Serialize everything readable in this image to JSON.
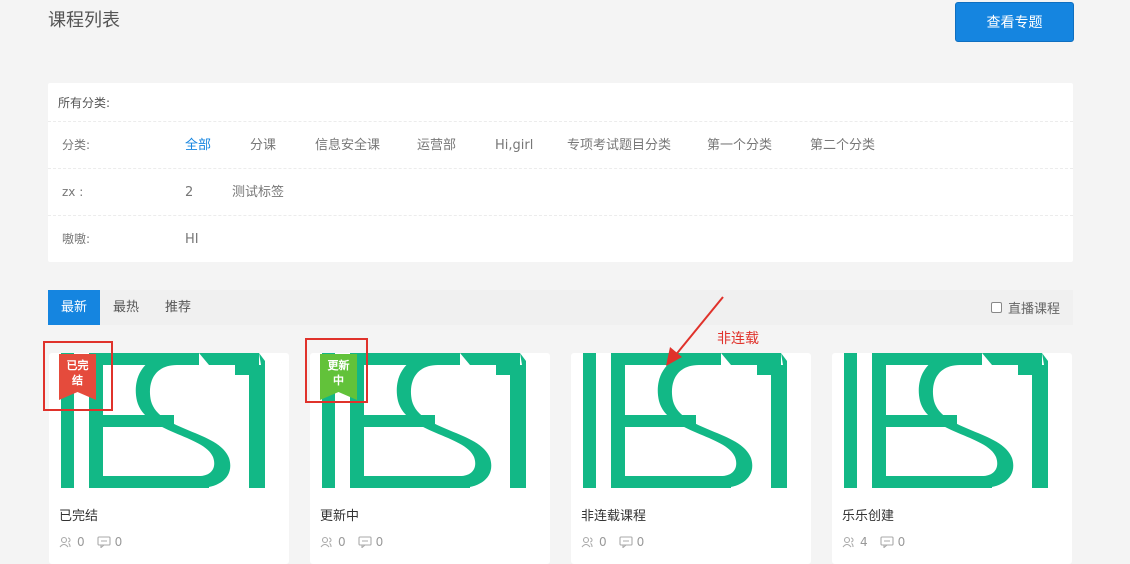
{
  "header": {
    "title": "课程列表",
    "topic_button": "查看专题"
  },
  "filters": {
    "heading": "所有分类:",
    "category": {
      "label": "分类:",
      "options": [
        "全部",
        "分课",
        "信息安全课",
        "运营部",
        "Hi,girl",
        "专项考试题目分类",
        "第一个分类",
        "第二个分类"
      ]
    },
    "zx": {
      "label": "zx :",
      "options": [
        "2",
        "测试标签"
      ]
    },
    "tag3": {
      "label": "嗷嗷:",
      "options": [
        "HI"
      ]
    }
  },
  "tabs": {
    "items": [
      "最新",
      "最热",
      "推荐"
    ],
    "live_label": "直播课程"
  },
  "courses": [
    {
      "title": "已完结",
      "learners": "0",
      "comments": "0",
      "badge": "已完\n结"
    },
    {
      "title": "更新中",
      "learners": "0",
      "comments": "0",
      "badge": "更新\n中"
    },
    {
      "title": "非连载课程",
      "learners": "0",
      "comments": "0"
    },
    {
      "title": "乐乐创建",
      "learners": "4",
      "comments": "0"
    }
  ],
  "annotation": "非连载",
  "colors": {
    "accent": "#1585e0",
    "logo": "#12b886",
    "ribbon_done": "#e54b3c",
    "ribbon_updating": "#62c23a",
    "highlight": "#e0322b"
  }
}
